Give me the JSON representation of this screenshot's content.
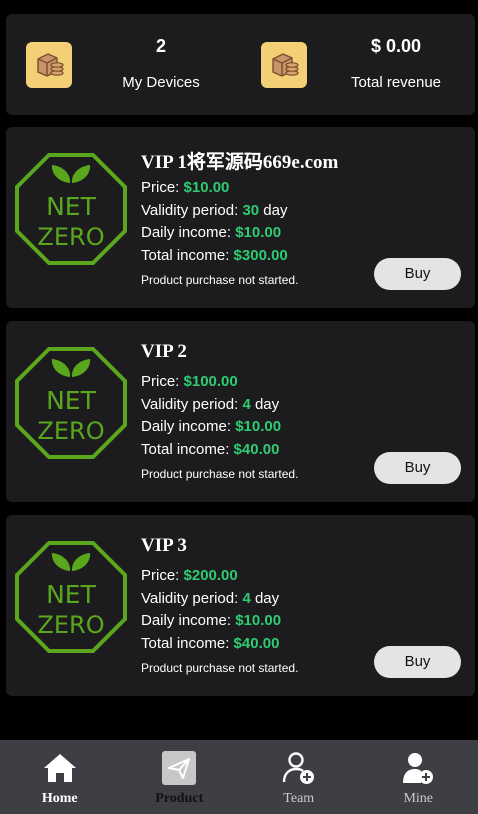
{
  "stats": {
    "devices_value": "2",
    "devices_label": "My Devices",
    "devices_icon": "box-coins-icon",
    "revenue_value": "$ 0.00",
    "revenue_label": "Total revenue",
    "revenue_icon": "box-coins-icon"
  },
  "product_logo": {
    "icon": "net-zero-badge-icon",
    "line1": "NET",
    "line2": "ZERO",
    "color": "#5aa61c"
  },
  "products": [
    {
      "title": "VIP 1将军源码669e.com",
      "price_label": "Price: ",
      "price": "$10.00",
      "validity_label": "Validity period: ",
      "validity_days": "30",
      "validity_unit": " day",
      "daily_label": "Daily income: ",
      "daily_income": "$10.00",
      "total_label": "Total income: ",
      "total_income": "$300.00",
      "status": "Product purchase not started.",
      "buy_label": "Buy"
    },
    {
      "title": "VIP 2",
      "price_label": "Price: ",
      "price": "$100.00",
      "validity_label": "Validity period: ",
      "validity_days": "4",
      "validity_unit": " day",
      "daily_label": "Daily income: ",
      "daily_income": "$10.00",
      "total_label": "Total income: ",
      "total_income": "$40.00",
      "status": "Product purchase not started.",
      "buy_label": "Buy"
    },
    {
      "title": "VIP 3",
      "price_label": "Price: ",
      "price": "$200.00",
      "validity_label": "Validity period: ",
      "validity_days": "4",
      "validity_unit": " day",
      "daily_label": "Daily income: ",
      "daily_income": "$10.00",
      "total_label": "Total income: ",
      "total_income": "$40.00",
      "status": "Product purchase not started.",
      "buy_label": "Buy"
    }
  ],
  "nav": {
    "items": [
      {
        "label": "Home",
        "icon": "home-icon"
      },
      {
        "label": "Product",
        "icon": "paper-plane-icon",
        "active": true
      },
      {
        "label": "Team",
        "icon": "add-user-icon"
      },
      {
        "label": "Mine",
        "icon": "user-add-icon"
      }
    ]
  },
  "colors": {
    "background": "#000000",
    "card": "#1c1c1f",
    "accent_green": "#2ecc71",
    "icon_tile": "#f3cf76",
    "nav_bar": "#3d3f44"
  }
}
